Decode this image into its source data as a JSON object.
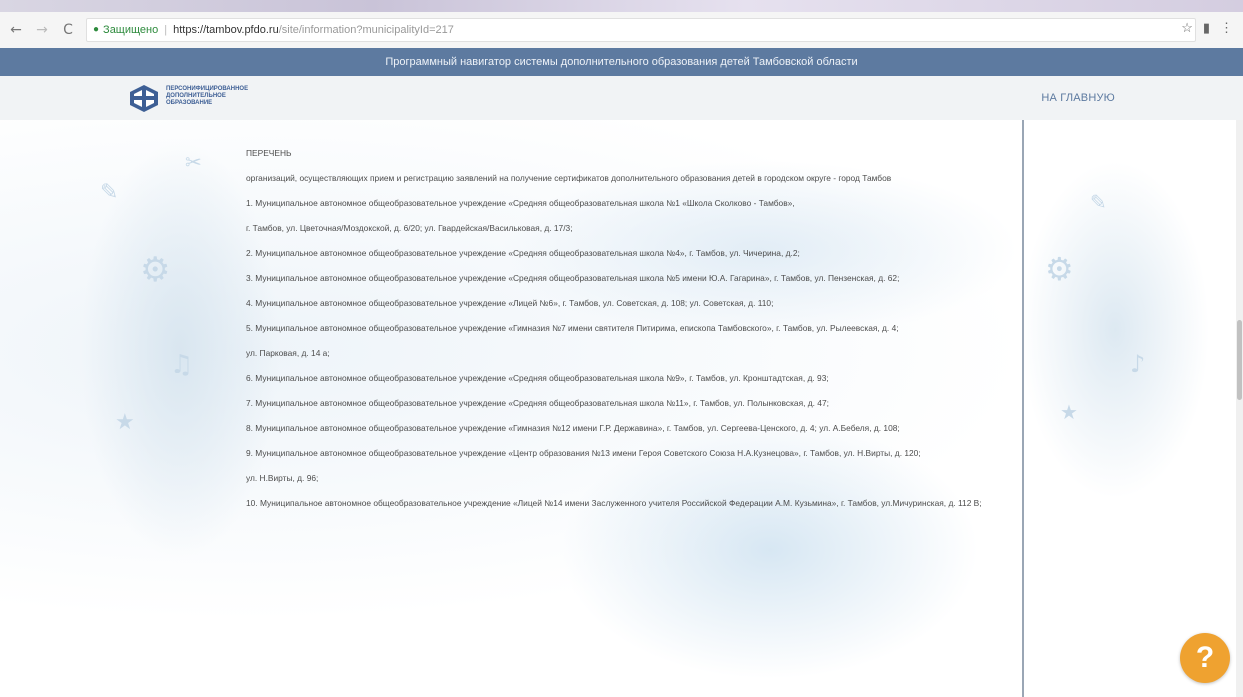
{
  "browser": {
    "back": "←",
    "forward": "→",
    "reload": "C",
    "secure_label": "Защищено",
    "url_host": "https://tambov.pfdo.ru",
    "url_path": "/site/information?municipalityId=217",
    "star": "☆",
    "menu": "⋮"
  },
  "site": {
    "banner": "Программный навигатор системы дополнительного образования детей Тамбовской области",
    "logo_line1": "ПЕРСОНИФИЦИРОВАННОЕ",
    "logo_line2": "ДОПОЛНИТЕЛЬНОЕ",
    "logo_line3": "ОБРАЗОВАНИЕ",
    "home_link": "НА ГЛАВНУЮ"
  },
  "content": {
    "heading": "ПЕРЕЧЕНЬ",
    "intro": "организаций, осуществляющих прием и регистрацию заявлений на получение сертификатов дополнительного образования детей в городском округе - город Тамбов",
    "items": [
      "1. Муниципальное автономное общеобразовательное учреждение «Средняя общеобразовательная школа №1 «Школа Сколково - Тамбов»,",
      "г. Тамбов, ул. Цветочная/Моздокской, д. 6/20; ул. Гвардейская/Васильковая, д. 17/3;",
      "2. Муниципальное автономное общеобразовательное учреждение «Средняя общеобразовательная школа №4», г. Тамбов, ул. Чичерина, д.2;",
      "3. Муниципальное автономное общеобразовательное учреждение «Средняя общеобразовательная школа №5 имени Ю.А. Гагарина», г. Тамбов, ул. Пензенская, д. 62;",
      "4. Муниципальное автономное общеобразовательное учреждение «Лицей №6», г. Тамбов, ул. Советская, д. 108; ул. Советская, д. 110;",
      "5. Муниципальное автономное общеобразовательное учреждение «Гимназия №7 имени святителя Питирима, епископа Тамбовского», г. Тамбов, ул. Рылеевская, д. 4;",
      "ул. Парковая, д. 14 а;",
      "6. Муниципальное автономное общеобразовательное учреждение «Средняя общеобразовательная школа №9», г. Тамбов, ул. Кронштадтская, д. 93;",
      "7. Муниципальное автономное общеобразовательное учреждение «Средняя общеобразовательная школа №11», г. Тамбов, ул. Полынковская, д. 47;",
      "8. Муниципальное автономное общеобразовательное учреждение «Гимназия №12 имени Г.Р. Державина», г. Тамбов, ул. Сергеева-Ценского, д. 4; ул. А.Бебеля, д. 108;",
      "9. Муниципальное автономное общеобразовательное учреждение «Центр образования №13 имени Героя Советского Союза Н.А.Кузнецова», г. Тамбов, ул. Н.Вирты, д. 120;",
      "ул. Н.Вирты, д. 96;",
      "10. Муниципальное автономное общеобразовательное учреждение «Лицей №14 имени Заслуженного учителя Российской Федерации А.М. Кузьмина», г. Тамбов, ул.Мичуринская, д. 112 В;"
    ]
  },
  "help_button": "?"
}
